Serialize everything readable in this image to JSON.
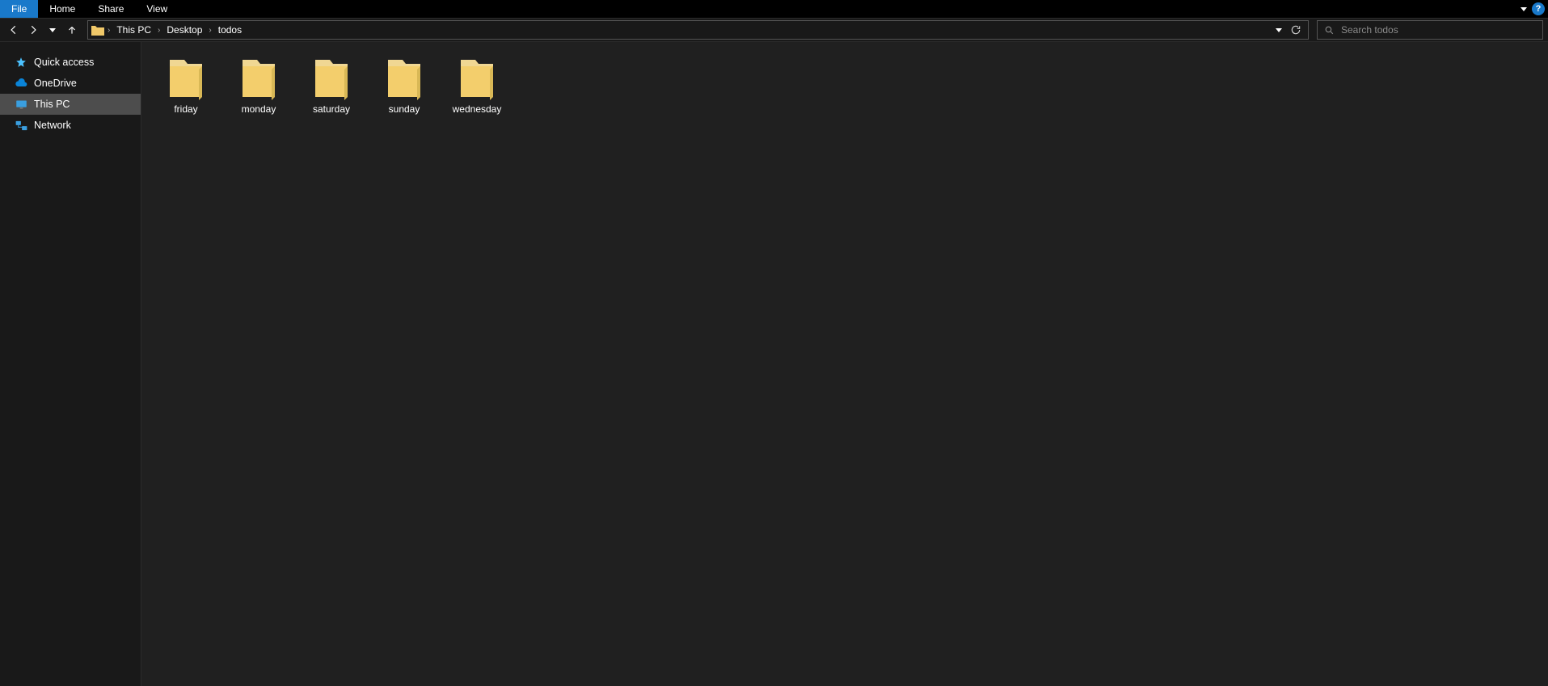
{
  "ribbon": {
    "tabs": [
      "File",
      "Home",
      "Share",
      "View"
    ]
  },
  "breadcrumb": {
    "segments": [
      "This PC",
      "Desktop",
      "todos"
    ]
  },
  "search": {
    "placeholder": "Search todos"
  },
  "sidebar": {
    "items": [
      {
        "label": "Quick access"
      },
      {
        "label": "OneDrive"
      },
      {
        "label": "This PC"
      },
      {
        "label": "Network"
      }
    ]
  },
  "folders": [
    {
      "name": "friday"
    },
    {
      "name": "monday"
    },
    {
      "name": "saturday"
    },
    {
      "name": "sunday"
    },
    {
      "name": "wednesday"
    }
  ]
}
